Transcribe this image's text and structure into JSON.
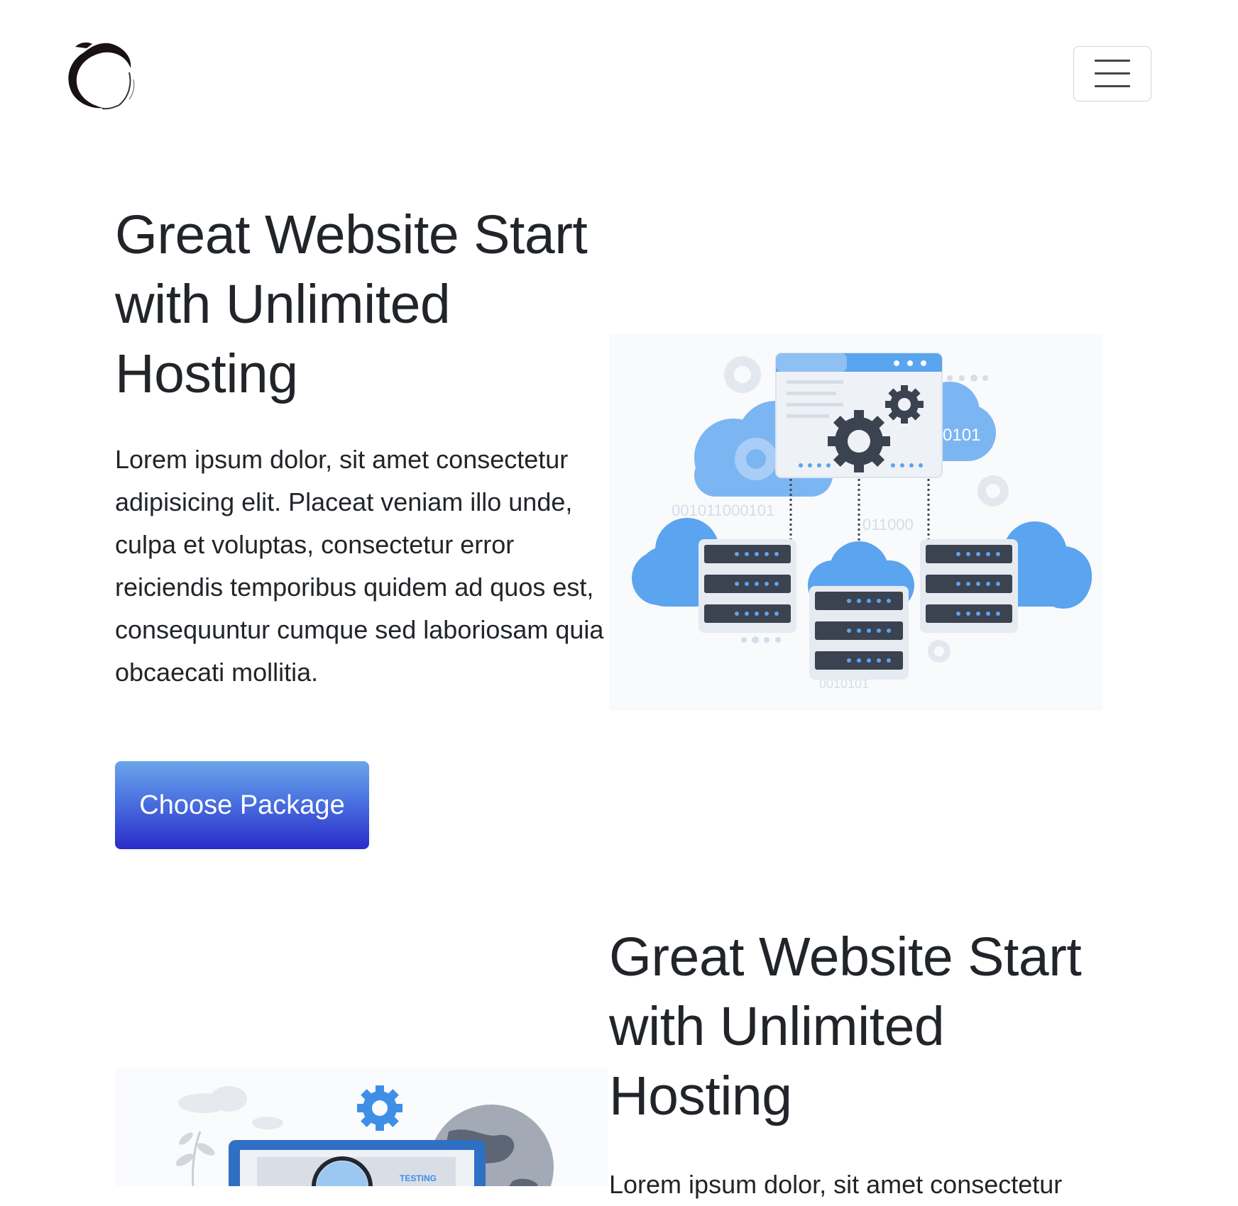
{
  "navbar": {
    "logo_icon": "crescent-logo",
    "menu_icon": "hamburger-menu-icon"
  },
  "hero": {
    "title": "Great Website Start with Unlimited Hosting",
    "description": "Lorem ipsum dolor, sit amet consectetur adipisicing elit. Placeat veniam illo unde, culpa et voluptas, consectetur error reiciendis temporibus quidem ad quos est, consequuntur cumque sed laboriosam quia obcaecati mollitia.",
    "button_label": "Choose Package",
    "illustration": {
      "binary_labels": [
        "001011000101",
        "011000",
        "0101",
        "0010101"
      ]
    }
  },
  "feature": {
    "title": "Great Website Start with Unlimited Hosting",
    "description": "Lorem ipsum dolor, sit amet consectetur",
    "illustration": {
      "label": "TESTING"
    }
  },
  "colors": {
    "button_top": "#6aa5ea",
    "button_bottom": "#2a2bc9",
    "cloud": "#5ba4ef",
    "server_dark": "#3b4250",
    "text": "#212529"
  }
}
